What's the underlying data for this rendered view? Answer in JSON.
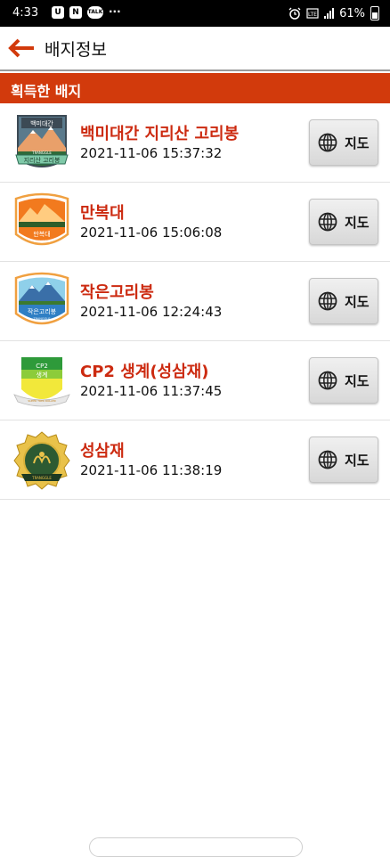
{
  "status_bar": {
    "time": "4:33",
    "notif_icons": [
      "U",
      "N",
      "TALK"
    ],
    "more": "···",
    "battery": "61%"
  },
  "app_bar": {
    "title": "배지정보",
    "back_icon": "arrow-left-icon",
    "accent": "#d23a0c"
  },
  "section": {
    "title": "획득한 배지"
  },
  "badges": [
    {
      "name": "백미대간 지리산 고리봉",
      "date": "2021-11-06 15:37:32",
      "map_label": "지도",
      "badge_top": "백미대간",
      "badge_bottom": "지리산 고리봉",
      "badge_sub": "TRANGGLE"
    },
    {
      "name": "만복대",
      "date": "2021-11-06 15:06:08",
      "map_label": "지도",
      "badge_top": "만복대",
      "badge_sub": "TRANGGLE"
    },
    {
      "name": "작은고리봉",
      "date": "2021-11-06 12:24:43",
      "map_label": "지도",
      "badge_top": "작은고리봉",
      "badge_sub": "TRANGGLE"
    },
    {
      "name": "CP2 생계(성삼재)",
      "date": "2021-11-06 11:37:45",
      "map_label": "지도",
      "badge_top": "CP2",
      "badge_bottom": "생계",
      "badge_sub": "SUPER TREK ROLLER"
    },
    {
      "name": "성삼재",
      "date": "2021-11-06 11:38:19",
      "map_label": "지도",
      "badge_sub": "TRANGGLE"
    }
  ],
  "colors": {
    "name_text": "#cc2a10",
    "section_bg": "#d23a0c"
  }
}
